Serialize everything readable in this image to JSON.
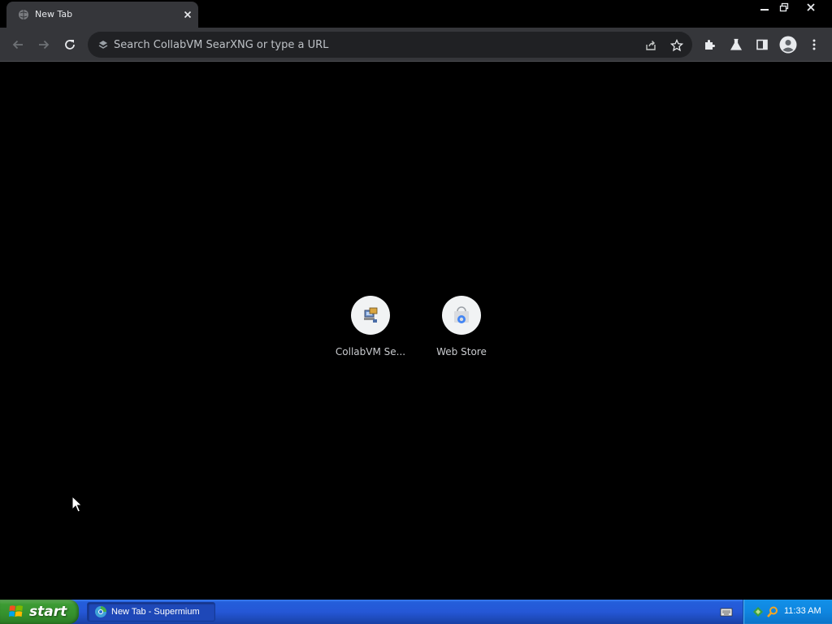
{
  "tab": {
    "title": "New Tab"
  },
  "omnibox": {
    "placeholder": "Search CollabVM SearXNG or type a URL"
  },
  "shortcuts": [
    {
      "label": "CollabVM Se..."
    },
    {
      "label": "Web Store"
    }
  ],
  "taskbar": {
    "start_label": "start",
    "task_label": "New Tab - Supermium",
    "clock": "11:33 AM"
  },
  "colors": {
    "toolbar": "#35363a",
    "omnibox": "#202124",
    "page_background": "#000000",
    "taskbar_blue": "#245edb",
    "start_green": "#3c9b33"
  },
  "icons": {
    "tab_favicon": "globe-icon",
    "tab_close": "close-icon",
    "back": "back-arrow-icon",
    "forward": "forward-arrow-icon",
    "reload": "reload-icon",
    "omnibox": "search-engine-icon",
    "share": "share-icon",
    "bookmark": "star-icon",
    "extensions": "puzzle-icon",
    "labs": "flask-icon",
    "side_panel": "side-panel-icon",
    "profile": "avatar-icon",
    "menu": "kebab-menu-icon"
  }
}
